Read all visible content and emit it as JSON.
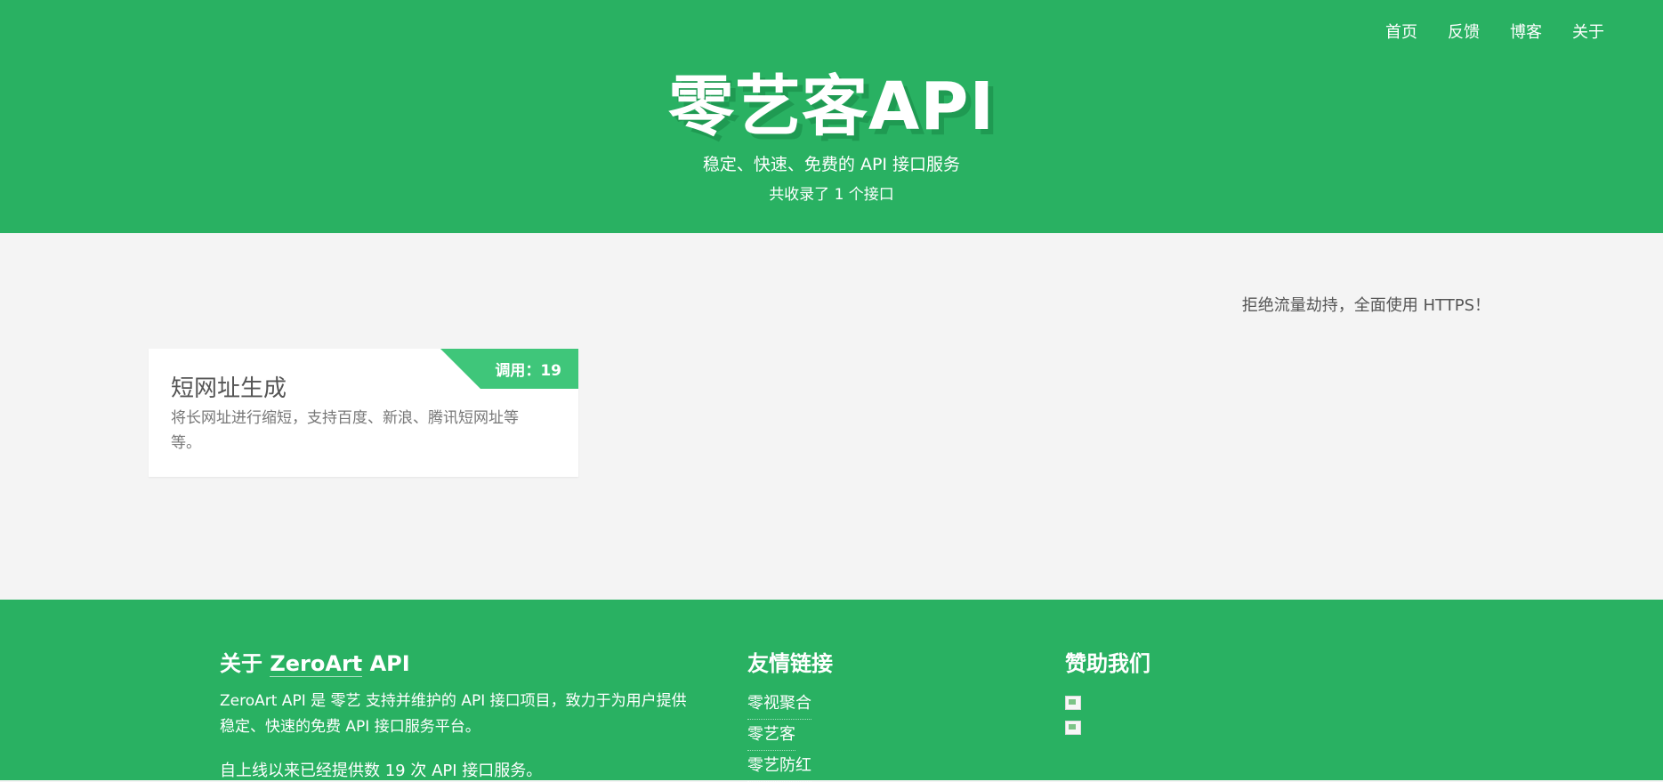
{
  "nav": {
    "items": [
      "首页",
      "反馈",
      "博客",
      "关于"
    ]
  },
  "header": {
    "title": "零艺客API",
    "tagline": "稳定、快速、免费的 API 接口服务",
    "count": "共收录了 1 个接口"
  },
  "notice": "拒绝流量劫持，全面使用 HTTPS！",
  "cards": [
    {
      "badge": "调用：19",
      "title": "短网址生成",
      "description": "将长网址进行缩短，支持百度、新浪、腾讯短网址等等。"
    }
  ],
  "footer": {
    "about": {
      "title_prefix": "关于 ",
      "brand": "ZeroArt",
      "title_suffix": " API",
      "text": "ZeroArt API 是 零艺 支持并维护的 API 接口项目，致力于为用户提供稳定、快速的免费 API 接口服务平台。",
      "stat": "自上线以来已经提供数 19 次 API 接口服务。"
    },
    "links": {
      "title": "友情链接",
      "items": [
        "零视聚合",
        "零艺客",
        "零艺防红"
      ]
    },
    "sponsor": {
      "title": "赞助我们"
    }
  },
  "colors": {
    "primary": "#29b162",
    "ribbon": "#3fc67a",
    "background": "#f4f4f4"
  }
}
